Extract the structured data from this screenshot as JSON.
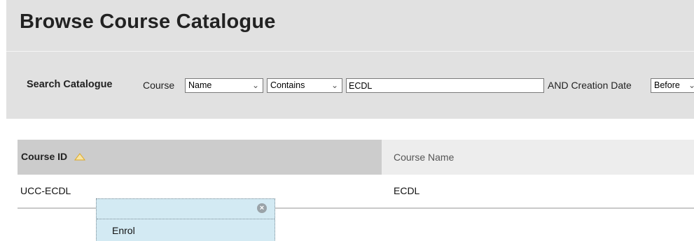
{
  "page": {
    "title": "Browse Course Catalogue"
  },
  "search": {
    "label": "Search Catalogue",
    "course_label": "Course",
    "field_select": "Name",
    "operator_select": "Contains",
    "query_value": "ECDL",
    "and_label": "AND Creation Date",
    "date_select": "Before"
  },
  "table": {
    "columns": [
      "Course ID",
      "Course Name"
    ],
    "rows": [
      {
        "course_id": "UCC-ECDL",
        "course_name": "ECDL"
      }
    ]
  },
  "popup": {
    "items": [
      "Enrol"
    ]
  },
  "icons": {
    "sort": "sort-ascending-icon",
    "close": "close-icon",
    "chevron": "chevron-down-icon"
  },
  "colors": {
    "header_bg": "#e1e1e1",
    "sorted_column_bg": "#cccccc",
    "column_bg": "#ededed",
    "popup_bg": "#d3eaf3",
    "sort_icon": "#f2c94c"
  }
}
